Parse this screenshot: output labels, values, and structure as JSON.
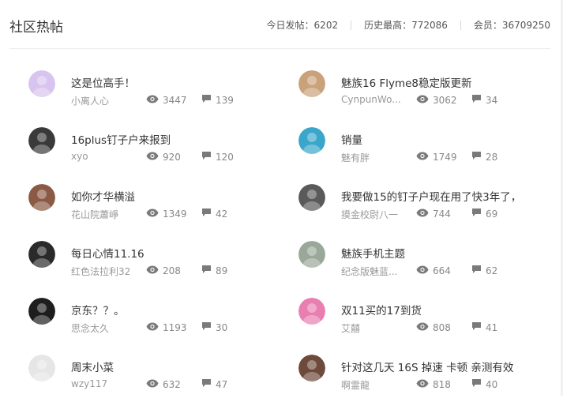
{
  "header": {
    "title": "社区热帖",
    "stats": [
      {
        "label": "今日发帖：6202"
      },
      {
        "label": "历史最高：772086"
      },
      {
        "label": "会员：36709250"
      }
    ]
  },
  "posts": [
    {
      "title": "这是位高手！",
      "author": "小离人心",
      "views": "3447",
      "replies": "139",
      "avatar_color": "#d8c4ee"
    },
    {
      "title": "魅族16 Flyme8稳定版更新",
      "author": "CynpunWo...",
      "views": "3062",
      "replies": "34",
      "avatar_color": "#c9a27a"
    },
    {
      "title": "16plus钉子户来报到",
      "author": "xyo",
      "views": "920",
      "replies": "120",
      "avatar_color": "#3a3a3a"
    },
    {
      "title": "销量",
      "author": "魅有胖",
      "views": "1749",
      "replies": "28",
      "avatar_color": "#3aa6c9"
    },
    {
      "title": "如你才华横溢",
      "author": "花山院蕭崢",
      "views": "1349",
      "replies": "42",
      "avatar_color": "#8a5a44"
    },
    {
      "title": "我要做15的钉子户现在用了快3年了，",
      "author": "摸金校尉八一",
      "views": "744",
      "replies": "69",
      "avatar_color": "#5a5a5a"
    },
    {
      "title": "每日心情11.16",
      "author": "红色法拉利32",
      "views": "208",
      "replies": "89",
      "avatar_color": "#2a2a2a"
    },
    {
      "title": "魅族手机主题",
      "author": "纪念版魅蓝...",
      "views": "664",
      "replies": "62",
      "avatar_color": "#9aa89a"
    },
    {
      "title": "京东？？。",
      "author": "思念太久",
      "views": "1193",
      "replies": "30",
      "avatar_color": "#1e1e1e"
    },
    {
      "title": "双11买的17到货",
      "author": "艾囍",
      "views": "808",
      "replies": "41",
      "avatar_color": "#e87fb0"
    },
    {
      "title": "周末小菜",
      "author": "wzy117",
      "views": "632",
      "replies": "47",
      "avatar_color": "#e6e6e6"
    },
    {
      "title": "针对这几天 16S 掉速 卡顿 亲测有效",
      "author": "啊霊龍",
      "views": "818",
      "replies": "40",
      "avatar_color": "#6e4a3a"
    }
  ]
}
